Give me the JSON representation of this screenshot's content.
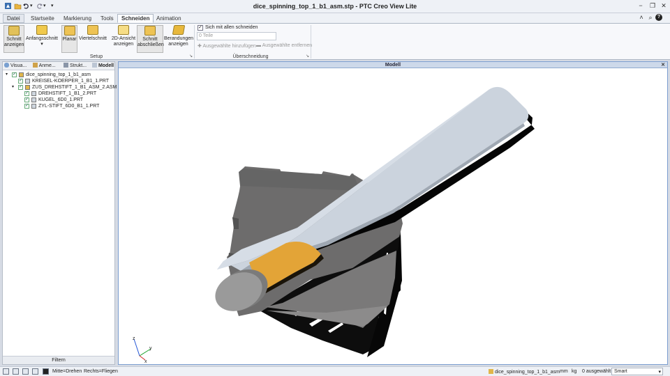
{
  "window": {
    "title": "dice_spinning_top_1_b1_asm.stp - PTC Creo View Lite",
    "minimize_glyph": "−",
    "restore_glyph": "❐",
    "close_glyph": "✕"
  },
  "quick_access": {
    "dropdown_glyph": "▾"
  },
  "tabs": [
    "Datei",
    "Startseite",
    "Markierung",
    "Tools",
    "Schneiden",
    "Animation"
  ],
  "active_tab": "Schneiden",
  "ribbon_right_glyphs": {
    "expand": "˄",
    "search": "⌕",
    "help": "?"
  },
  "ribbon": {
    "setup": {
      "label": "Setup",
      "buttons": [
        {
          "line1": "Schnitt",
          "line2": "anzeigen",
          "icon": "section-view-icon"
        },
        {
          "line1": "Anfangsschnitt",
          "line2": "▾",
          "icon": "initial-cut-icon"
        },
        {
          "line1": "Planar",
          "line2": "",
          "icon": "planar-icon"
        },
        {
          "line1": "Viertelschnitt",
          "line2": "",
          "icon": "quarter-cut-icon"
        },
        {
          "line1": "2D-Ansicht",
          "line2": "anzeigen",
          "icon": "2d-view-icon"
        },
        {
          "line1": "Schnitt",
          "line2": "abschließen",
          "icon": "finish-section-icon"
        },
        {
          "line1": "Berandungen",
          "line2": "anzeigen",
          "icon": "boundaries-icon"
        }
      ]
    },
    "overlap": {
      "label": "Überschneidung",
      "cut_all_label": "Sich mit allen schneiden",
      "cut_all_checked": true,
      "parts_value": "0 Teile",
      "add_selected": "Ausgewählte hinzufügen",
      "remove_selected": "Ausgewählte entfernen"
    },
    "launcher_glyph": "↘"
  },
  "left_panel": {
    "tabs": [
      "Visua...",
      "Anme...",
      "Strukt...",
      "Modell"
    ],
    "active_tab": "Modell",
    "tree": [
      {
        "label": "dice_spinning_top_1_b1_asm",
        "level": 0,
        "expander": "▾",
        "checked": true,
        "kind": "assembly"
      },
      {
        "label": "KREISEL-KOERPER_1_B1_1.PRT",
        "level": 1,
        "expander": "",
        "checked": true,
        "kind": "part"
      },
      {
        "label": "ZUS_DREHSTIFT_1_B1_ASM_2.ASM",
        "level": 1,
        "expander": "▾",
        "checked": true,
        "kind": "assembly"
      },
      {
        "label": "DREHSTIFT_1_B1_2.PRT",
        "level": 2,
        "expander": "",
        "checked": true,
        "kind": "part"
      },
      {
        "label": "KUGEL_6D0_1.PRT",
        "level": 2,
        "expander": "",
        "checked": true,
        "kind": "part"
      },
      {
        "label": "ZYL-STIFT_6D0_B1_1.PRT",
        "level": 2,
        "expander": "",
        "checked": true,
        "kind": "part"
      }
    ],
    "filter_label": "Filtern"
  },
  "viewport": {
    "title": "Modell",
    "close_glyph": "✕",
    "axes": {
      "x": "x",
      "y": "y",
      "z": "z"
    }
  },
  "status": {
    "mouse_hint1": "Mitte=Drehen",
    "mouse_hint2": "Rechts=Fliegen",
    "model_name": "dice_spinning_top_1_b1_asm",
    "unit_length": "mm",
    "unit_mass": "kg",
    "selected": "0 ausgewählt",
    "mode": "Smart",
    "mode_glyph": "▾"
  },
  "colors": {
    "accent_blue": "#2d5fa6",
    "section_cap": "#e3a437",
    "body_grey": "#9b9b9b",
    "pin_blue": "#cfd8e3"
  }
}
